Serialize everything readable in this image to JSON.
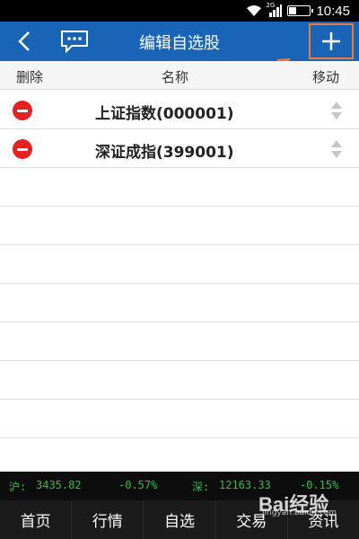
{
  "status": {
    "time": "10:45",
    "network": "2G"
  },
  "header": {
    "title": "编辑自选股",
    "icons": [
      "back-icon",
      "chat-icon",
      "plus-icon",
      "annotation-arrow"
    ]
  },
  "columns": {
    "delete": "删除",
    "name": "名称",
    "move": "移动"
  },
  "stocks": [
    {
      "name": "上证指数(000001)"
    },
    {
      "name": "深证成指(399001)"
    }
  ],
  "ticker": {
    "sh_label": "沪:",
    "sh_value": "3435.82",
    "sh_change": "-0.57%",
    "sz_label": "深:",
    "sz_value": "12163.33",
    "sz_change": "-0.15%"
  },
  "nav": [
    "首页",
    "行情",
    "自选",
    "交易",
    "资讯"
  ],
  "watermark": {
    "text": "Bai经验",
    "url": "jingyan.baidu.com"
  },
  "colors": {
    "header": "#1a64b8",
    "accent_annotation": "#f07a3a",
    "delete": "#e62121",
    "ticker_text": "#2fbf4a"
  }
}
